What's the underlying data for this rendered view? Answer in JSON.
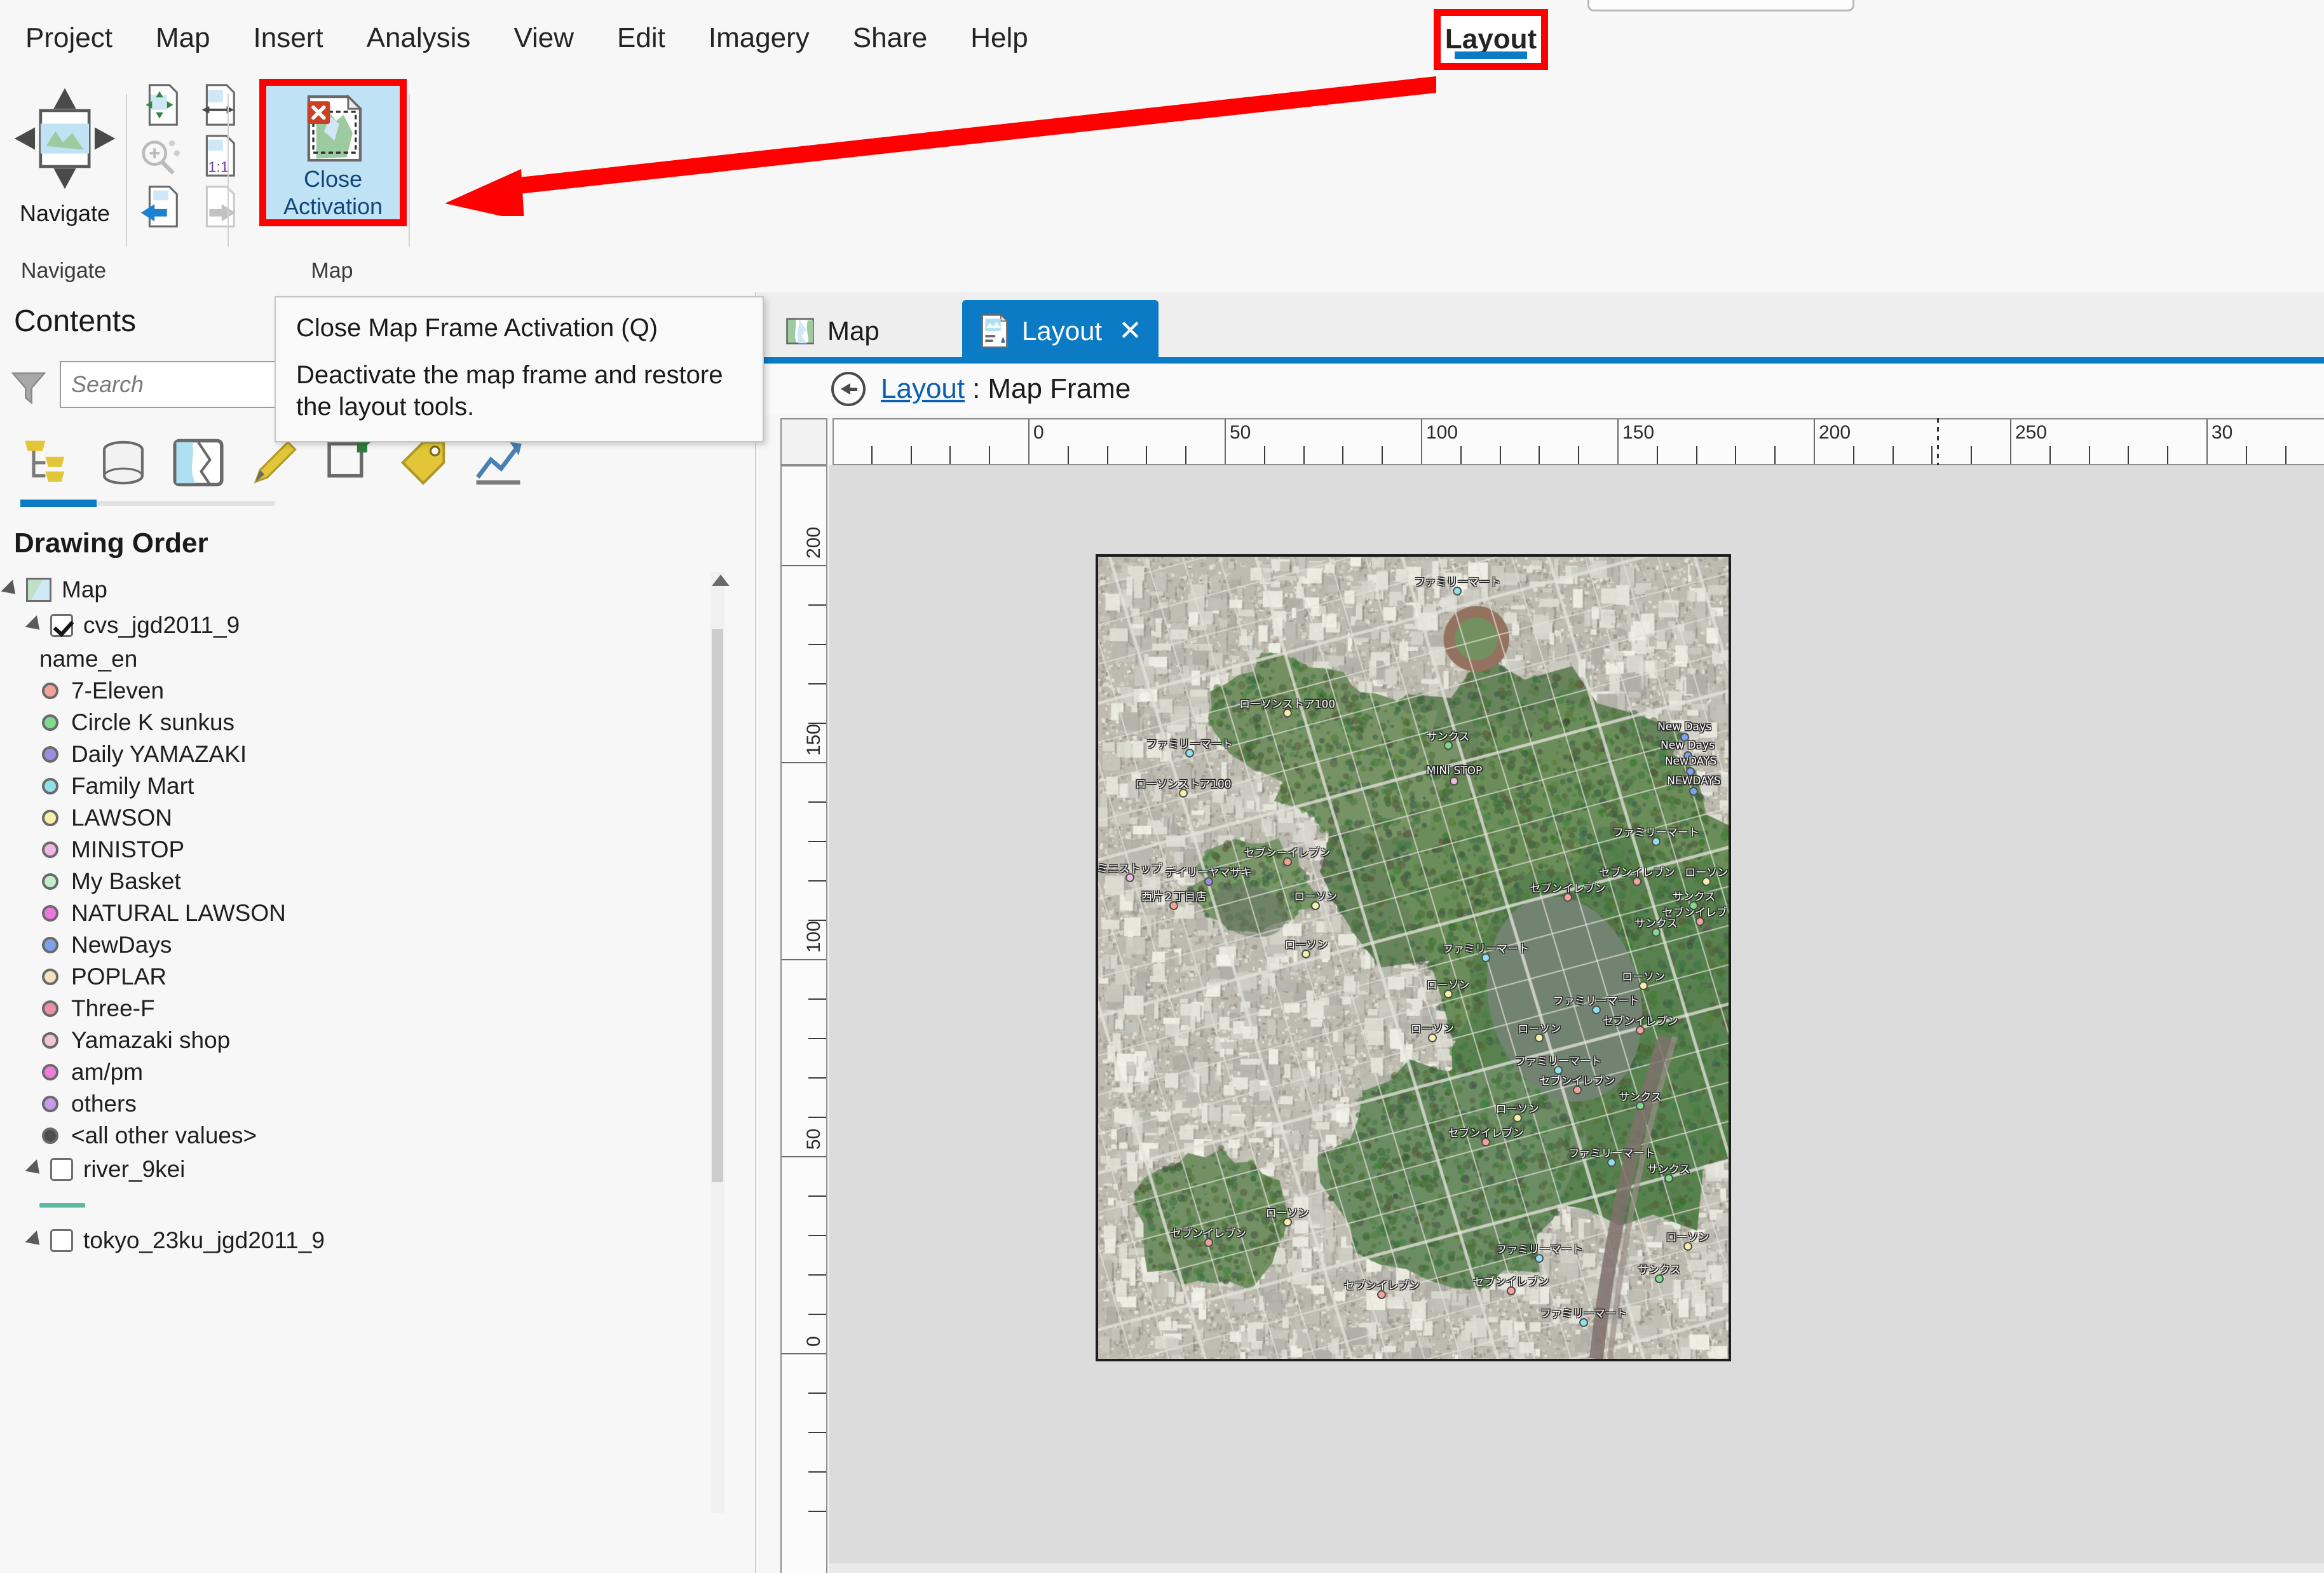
{
  "ribbon": {
    "tabs": [
      {
        "label": "Project",
        "active": false
      },
      {
        "label": "Map",
        "active": false
      },
      {
        "label": "Insert",
        "active": false
      },
      {
        "label": "Analysis",
        "active": false
      },
      {
        "label": "View",
        "active": false
      },
      {
        "label": "Edit",
        "active": false
      },
      {
        "label": "Imagery",
        "active": false
      },
      {
        "label": "Share",
        "active": false
      },
      {
        "label": "Help",
        "active": false
      }
    ],
    "highlighted_tab": {
      "label": "Layout",
      "active": true,
      "highlight_color": "#fe0000",
      "underline_color": "#0a7bc4"
    },
    "groups": [
      {
        "name": "Navigate",
        "label": "Navigate",
        "buttons": [
          {
            "label": "Navigate",
            "icon": "navigate-page-icon"
          }
        ]
      },
      {
        "name": "Tools",
        "label": "",
        "buttons": [
          {
            "label": "",
            "icon": "fixed-zoom-page-icon"
          },
          {
            "label": "",
            "icon": "full-extent-page-icon"
          },
          {
            "label": "",
            "icon": "zoom-to-selection-icon"
          },
          {
            "label": "",
            "icon": "scale-1to1-page-icon"
          },
          {
            "label": "",
            "icon": "previous-extent-icon"
          },
          {
            "label": "",
            "icon": "next-extent-icon"
          }
        ]
      },
      {
        "name": "Map",
        "label": "Map",
        "buttons": [
          {
            "label": "Close Activation",
            "label_line1": "Close",
            "label_line2": "Activation",
            "icon": "close-map-frame-activation-icon",
            "selected": true
          }
        ]
      }
    ]
  },
  "tooltip": {
    "title": "Close Map Frame Activation (Q)",
    "body": "Deactivate the map frame and restore the layout tools."
  },
  "contents": {
    "title": "Contents",
    "search_placeholder": "Search",
    "search_value": "",
    "tabs": [
      {
        "icon": "drawing-order-icon",
        "active": true
      },
      {
        "icon": "data-source-icon",
        "active": false
      },
      {
        "icon": "selection-map-icon",
        "active": false
      },
      {
        "icon": "editing-pencil-icon",
        "active": false
      },
      {
        "icon": "snapping-icon",
        "active": false
      },
      {
        "icon": "labeling-tag-icon",
        "active": false
      },
      {
        "icon": "charts-icon",
        "active": false
      }
    ],
    "section_heading": "Drawing Order",
    "tree": [
      {
        "type": "map",
        "label": "Map",
        "indent": 0,
        "expanded": true,
        "icon": "map-thumbnail-icon"
      },
      {
        "type": "layer",
        "label": "cvs_jgd2011_9",
        "indent": 1,
        "expanded": true,
        "checked": true
      },
      {
        "type": "field",
        "label": "name_en",
        "indent": 2
      },
      {
        "type": "symbol",
        "label": "7-Eleven",
        "indent": 3,
        "color": "#f5a39a"
      },
      {
        "type": "symbol",
        "label": "Circle K sunkus",
        "indent": 3,
        "color": "#7fdb8c"
      },
      {
        "type": "symbol",
        "label": "Daily YAMAZAKI",
        "indent": 3,
        "color": "#9a8ede"
      },
      {
        "type": "symbol",
        "label": "Family Mart",
        "indent": 3,
        "color": "#8fe0ee"
      },
      {
        "type": "symbol",
        "label": "LAWSON",
        "indent": 3,
        "color": "#f5f0a8"
      },
      {
        "type": "symbol",
        "label": "MINISTOP",
        "indent": 3,
        "color": "#f0b6e4"
      },
      {
        "type": "symbol",
        "label": "My Basket",
        "indent": 3,
        "color": "#bff0c8"
      },
      {
        "type": "symbol",
        "label": "NATURAL LAWSON",
        "indent": 3,
        "color": "#ee77dd"
      },
      {
        "type": "symbol",
        "label": "NewDays",
        "indent": 3,
        "color": "#7da2ea"
      },
      {
        "type": "symbol",
        "label": "POPLAR",
        "indent": 3,
        "color": "#f5e0c0"
      },
      {
        "type": "symbol",
        "label": "Three-F",
        "indent": 3,
        "color": "#ee8fa8"
      },
      {
        "type": "symbol",
        "label": "Yamazaki shop",
        "indent": 3,
        "color": "#f5c4d4"
      },
      {
        "type": "symbol",
        "label": "am/pm",
        "indent": 3,
        "color": "#ee7ddd"
      },
      {
        "type": "symbol",
        "label": "others",
        "indent": 3,
        "color": "#c79aee"
      },
      {
        "type": "symbol",
        "label": "<all other values>",
        "indent": 3,
        "color": "#4d4d4d"
      },
      {
        "type": "layer",
        "label": "river_9kei",
        "indent": 1,
        "expanded": true,
        "checked": false
      },
      {
        "type": "linesymbol",
        "label": "",
        "indent": 3,
        "color": "#5fb8a3"
      },
      {
        "type": "layer",
        "label": "tokyo_23ku_jgd2011_9",
        "indent": 1,
        "expanded": true,
        "checked": false
      }
    ]
  },
  "view": {
    "tabs": [
      {
        "label": "Map",
        "active": false,
        "icon": "map-view-icon",
        "closable": false
      },
      {
        "label": "Layout",
        "active": true,
        "icon": "layout-view-icon",
        "closable": true,
        "close_glyph": "✕"
      }
    ],
    "breadcrumb": {
      "back_icon": "back-arrow-icon",
      "root": "Layout",
      "separator": ":",
      "current": "Map Frame"
    },
    "ruler": {
      "horizontal_ticks": [
        "0",
        "50",
        "100",
        "150",
        "200",
        "250",
        "30"
      ],
      "vertical_ticks": [
        "200",
        "150",
        "100",
        "50",
        "0"
      ],
      "units": "mm",
      "guide_position": "185"
    }
  },
  "map": {
    "basemap": "satellite-imagery",
    "area": "Tokyo - Ueno / Hongo district",
    "points": [
      {
        "label": "ミニストップ",
        "x": 0.05,
        "y": 0.4,
        "color": "#f0b6e4"
      },
      {
        "label": "西片２丁目店",
        "x": 0.12,
        "y": 0.435,
        "color": "#f5a39a"
      },
      {
        "label": "セブン－イレブン",
        "x": 0.3,
        "y": 0.38,
        "color": "#f5a39a"
      },
      {
        "label": "ファミリーマート",
        "x": 0.57,
        "y": 0.043,
        "color": "#8fe0ee"
      },
      {
        "label": "ローソンストア100",
        "x": 0.3,
        "y": 0.195,
        "color": "#f5f0a8"
      },
      {
        "label": "サンクス",
        "x": 0.555,
        "y": 0.235,
        "color": "#7fdb8c"
      },
      {
        "label": "MINI STOP",
        "x": 0.565,
        "y": 0.28,
        "color": "#f0b6e4"
      },
      {
        "label": "ファミリーマート",
        "x": 0.145,
        "y": 0.245,
        "color": "#8fe0ee"
      },
      {
        "label": "ローソンストア100",
        "x": 0.135,
        "y": 0.295,
        "color": "#f5f0a8"
      },
      {
        "label": "デイリーヤマザキ",
        "x": 0.175,
        "y": 0.405,
        "color": "#9a8ede"
      },
      {
        "label": "ローソン",
        "x": 0.345,
        "y": 0.435,
        "color": "#f5f0a8"
      },
      {
        "label": "ローソン",
        "x": 0.33,
        "y": 0.495,
        "color": "#f5f0a8"
      },
      {
        "label": "New Days",
        "x": 0.93,
        "y": 0.225,
        "color": "#7da2ea"
      },
      {
        "label": "New Days",
        "x": 0.935,
        "y": 0.248,
        "color": "#7da2ea"
      },
      {
        "label": "NewDAYS",
        "x": 0.94,
        "y": 0.268,
        "color": "#7da2ea"
      },
      {
        "label": "NEWDAYS",
        "x": 0.945,
        "y": 0.292,
        "color": "#7da2ea"
      },
      {
        "label": "ファミリーマート",
        "x": 0.885,
        "y": 0.355,
        "color": "#8fe0ee"
      },
      {
        "label": "セブンイレブン",
        "x": 0.855,
        "y": 0.405,
        "color": "#f5a39a"
      },
      {
        "label": "セブンイレブン",
        "x": 0.745,
        "y": 0.425,
        "color": "#f5a39a"
      },
      {
        "label": "ローソン",
        "x": 0.965,
        "y": 0.405,
        "color": "#f5f0a8"
      },
      {
        "label": "サンクス",
        "x": 0.945,
        "y": 0.435,
        "color": "#7fdb8c"
      },
      {
        "label": "セブンイレブン",
        "x": 0.955,
        "y": 0.455,
        "color": "#f5a39a"
      },
      {
        "label": "サンクス",
        "x": 0.885,
        "y": 0.468,
        "color": "#7fdb8c"
      },
      {
        "label": "ローソン",
        "x": 0.555,
        "y": 0.545,
        "color": "#f5f0a8"
      },
      {
        "label": "ローソン",
        "x": 0.53,
        "y": 0.6,
        "color": "#f5f0a8"
      },
      {
        "label": "ファミリーマート",
        "x": 0.615,
        "y": 0.5,
        "color": "#8fe0ee"
      },
      {
        "label": "ローソン",
        "x": 0.865,
        "y": 0.535,
        "color": "#f5f0a8"
      },
      {
        "label": "ファミリーマート",
        "x": 0.79,
        "y": 0.565,
        "color": "#8fe0ee"
      },
      {
        "label": "セブンイレブン",
        "x": 0.86,
        "y": 0.59,
        "color": "#f5a39a"
      },
      {
        "label": "ローソン",
        "x": 0.7,
        "y": 0.6,
        "color": "#f5f0a8"
      },
      {
        "label": "ファミリーマート",
        "x": 0.73,
        "y": 0.64,
        "color": "#8fe0ee"
      },
      {
        "label": "セブンイレブン",
        "x": 0.76,
        "y": 0.665,
        "color": "#f5a39a"
      },
      {
        "label": "ローソン",
        "x": 0.665,
        "y": 0.7,
        "color": "#f5f0a8"
      },
      {
        "label": "サンクス",
        "x": 0.86,
        "y": 0.685,
        "color": "#7fdb8c"
      },
      {
        "label": "セブンイレブン",
        "x": 0.615,
        "y": 0.73,
        "color": "#f5a39a"
      },
      {
        "label": "ファミリーマート",
        "x": 0.815,
        "y": 0.755,
        "color": "#8fe0ee"
      },
      {
        "label": "サンクス",
        "x": 0.905,
        "y": 0.775,
        "color": "#7fdb8c"
      },
      {
        "label": "セブンイレブン",
        "x": 0.175,
        "y": 0.855,
        "color": "#f5a39a"
      },
      {
        "label": "ローソン",
        "x": 0.3,
        "y": 0.83,
        "color": "#f5f0a8"
      },
      {
        "label": "セブンイレブン",
        "x": 0.45,
        "y": 0.92,
        "color": "#f5a39a"
      },
      {
        "label": "ファミリーマート",
        "x": 0.7,
        "y": 0.875,
        "color": "#8fe0ee"
      },
      {
        "label": "セブンイレブン",
        "x": 0.655,
        "y": 0.915,
        "color": "#f5a39a"
      },
      {
        "label": "サンクス",
        "x": 0.89,
        "y": 0.9,
        "color": "#7fdb8c"
      },
      {
        "label": "ローソン",
        "x": 0.935,
        "y": 0.86,
        "color": "#f5f0a8"
      },
      {
        "label": "ファミリーマート",
        "x": 0.77,
        "y": 0.955,
        "color": "#8fe0ee"
      }
    ]
  }
}
